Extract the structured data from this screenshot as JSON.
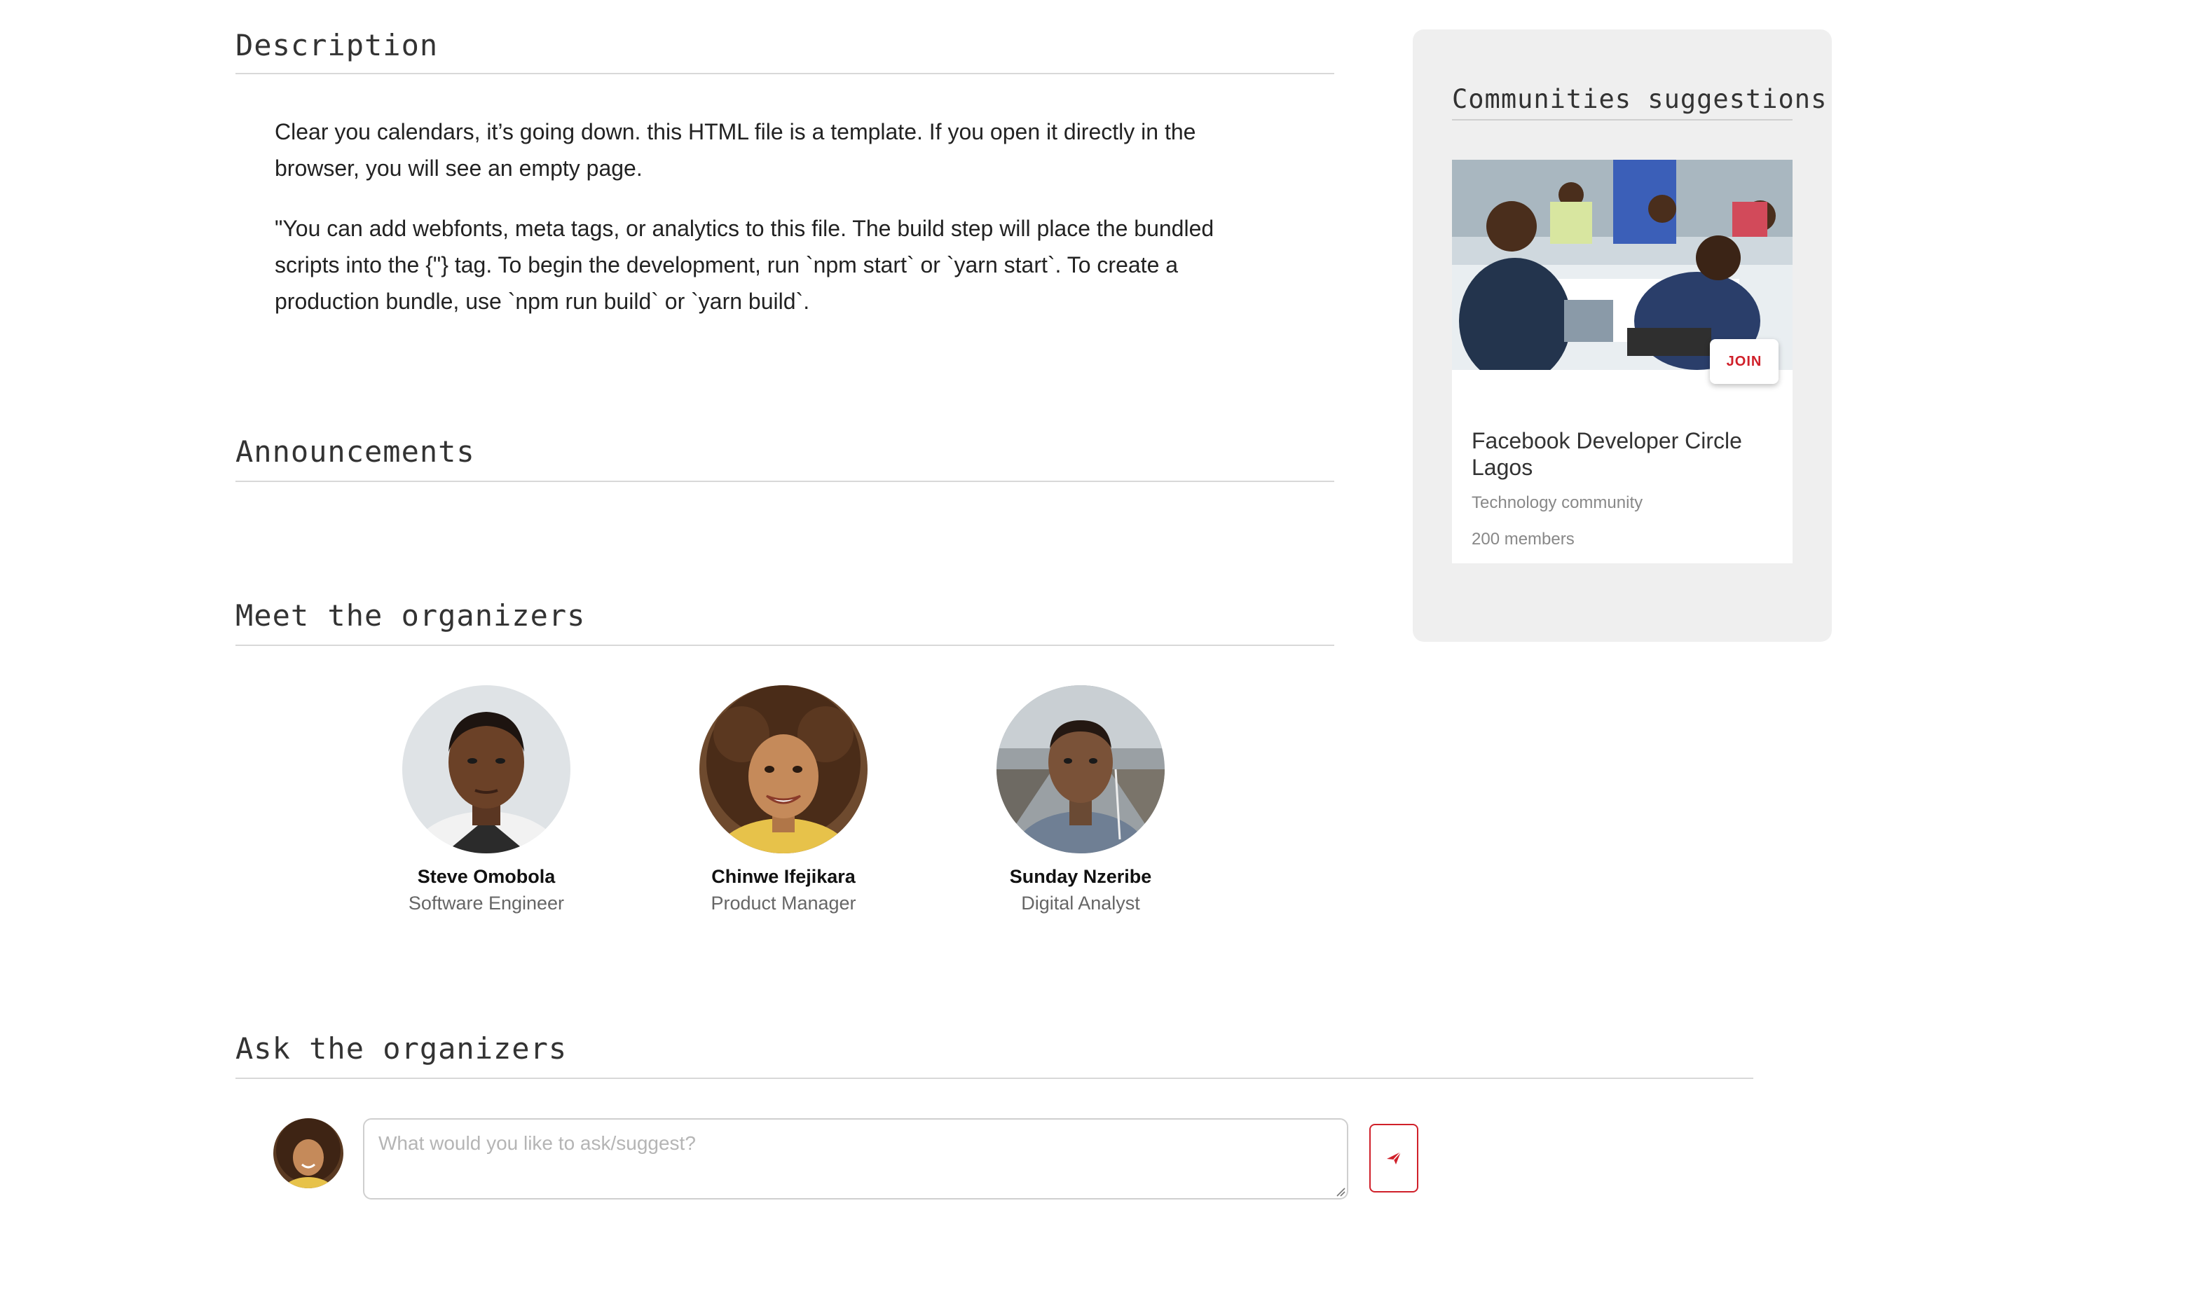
{
  "description": {
    "title": "Description",
    "paragraph1": "Clear you calendars, it’s going down. this HTML file is a template. If you open it directly in the browser, you will see an empty page.",
    "paragraph2": "\"You can add webfonts, meta tags, or analytics to this file.  The build step will place the bundled scripts into the {\"} tag.  To begin the development, run `npm start` or `yarn start`.  To create a production bundle, use `npm run build` or `yarn build`."
  },
  "announcements": {
    "title": "Announcements"
  },
  "organizers": {
    "title": "Meet the organizers",
    "people": [
      {
        "name": "Steve Omobola",
        "role": "Software Engineer"
      },
      {
        "name": "Chinwe Ifejikara",
        "role": "Product Manager"
      },
      {
        "name": "Sunday Nzeribe",
        "role": "Digital Analyst"
      }
    ]
  },
  "ask": {
    "title": "Ask the organizers",
    "placeholder": "What would you like to ask/suggest?",
    "value": "",
    "send_icon": "paper-plane-icon"
  },
  "sidebar": {
    "title": "Communities suggestions",
    "community": {
      "name": "Facebook Developer Circle Lagos",
      "type": "Technology community",
      "members": "200 members",
      "join_label": "JOIN"
    }
  },
  "colors": {
    "accent": "#d0202a",
    "sidebar_bg": "#efefef",
    "rule": "#d8d8d8"
  }
}
